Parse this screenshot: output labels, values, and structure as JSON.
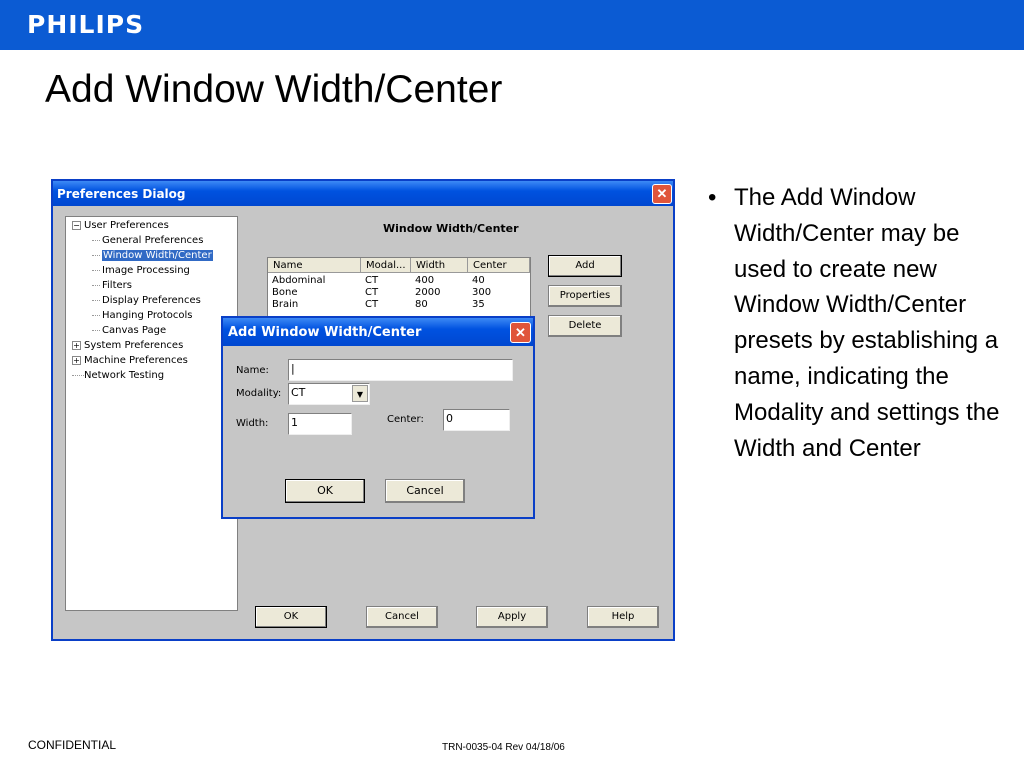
{
  "header": {
    "logo": "PHILIPS"
  },
  "slide_title": "Add Window Width/Center",
  "prefs": {
    "title": "Preferences Dialog",
    "tree": [
      {
        "label": "User Preferences",
        "level": 0,
        "expander": "−"
      },
      {
        "label": "General Preferences",
        "level": 1
      },
      {
        "label": "Window Width/Center",
        "level": 1,
        "selected": true
      },
      {
        "label": "Image Processing",
        "level": 1
      },
      {
        "label": "Filters",
        "level": 1
      },
      {
        "label": "Display Preferences",
        "level": 1
      },
      {
        "label": "Hanging Protocols",
        "level": 1
      },
      {
        "label": "Canvas Page",
        "level": 1
      },
      {
        "label": "System Preferences",
        "level": 0,
        "expander": "+"
      },
      {
        "label": "Machine Preferences",
        "level": 0,
        "expander": "+"
      },
      {
        "label": "Network Testing",
        "level": 0
      }
    ],
    "panel_title": "Window Width/Center",
    "table": {
      "headers": [
        "Name",
        "Modal...",
        "Width",
        "Center"
      ],
      "rows": [
        [
          "Abdominal",
          "CT",
          "400",
          "40"
        ],
        [
          "Bone",
          "CT",
          "2000",
          "300"
        ],
        [
          "Brain",
          "CT",
          "80",
          "35"
        ]
      ]
    },
    "side_buttons": [
      "Add",
      "Properties",
      "Delete"
    ],
    "bottom_buttons": [
      "OK",
      "Cancel",
      "Apply",
      "Help"
    ]
  },
  "add_dialog": {
    "title": "Add Window Width/Center",
    "name_label": "Name:",
    "name_value": "",
    "modality_label": "Modality:",
    "modality_value": "CT",
    "width_label": "Width:",
    "width_value": "1",
    "center_label": "Center:",
    "center_value": "0",
    "ok": "OK",
    "cancel": "Cancel"
  },
  "bullet": "The Add Window Width/Center may be used to create new Window Width/Center presets by establishing a name, indicating the Modality and settings the Width and Center",
  "footer": {
    "left": "CONFIDENTIAL",
    "center": "TRN-0035-04 Rev 04/18/06"
  }
}
